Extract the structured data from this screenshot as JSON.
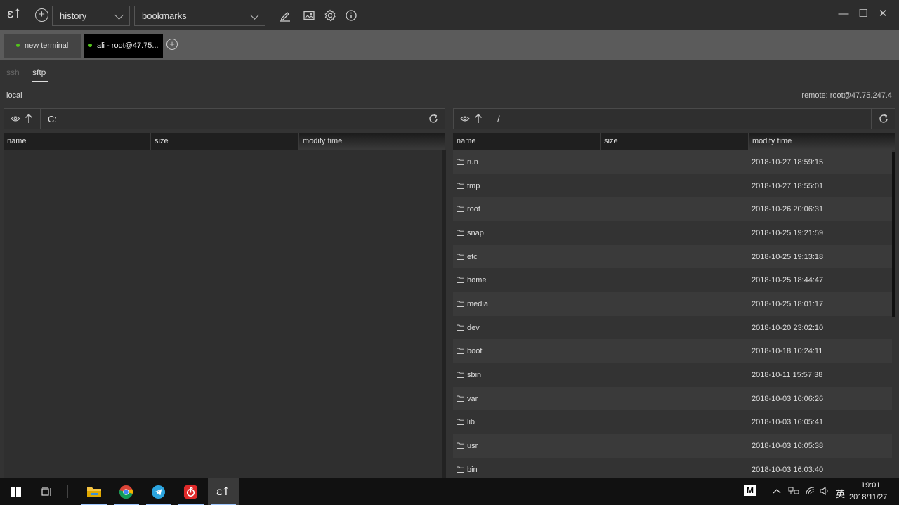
{
  "app": {
    "logo_text": "ɛ↑"
  },
  "toolbar": {
    "history_label": "history",
    "bookmarks_label": "bookmarks"
  },
  "window_controls": {
    "minimize": "—",
    "maximize": "☐",
    "close": "✕"
  },
  "tabs": [
    {
      "label": "new terminal",
      "status": "connected",
      "status_color": "#52c41a"
    },
    {
      "label": "ali - root@47.75...",
      "status": "connected",
      "status_color": "#52c41a",
      "active": true
    }
  ],
  "subtabs": {
    "ssh": "ssh",
    "sftp": "sftp",
    "active": "sftp"
  },
  "local": {
    "label": "local",
    "path": "C:",
    "columns": [
      "name",
      "size",
      "modify time"
    ]
  },
  "remote": {
    "label": "remote: root@47.75.247.4",
    "path": "/",
    "columns": [
      "name",
      "size",
      "modify time"
    ],
    "files": [
      {
        "name": "run",
        "time": "2018-10-27 18:59:15"
      },
      {
        "name": "tmp",
        "time": "2018-10-27 18:55:01"
      },
      {
        "name": "root",
        "time": "2018-10-26 20:06:31"
      },
      {
        "name": "snap",
        "time": "2018-10-25 19:21:59"
      },
      {
        "name": "etc",
        "time": "2018-10-25 19:13:18"
      },
      {
        "name": "home",
        "time": "2018-10-25 18:44:47"
      },
      {
        "name": "media",
        "time": "2018-10-25 18:01:17"
      },
      {
        "name": "dev",
        "time": "2018-10-20 23:02:10"
      },
      {
        "name": "boot",
        "time": "2018-10-18 10:24:11"
      },
      {
        "name": "sbin",
        "time": "2018-10-11 15:57:38"
      },
      {
        "name": "var",
        "time": "2018-10-03 16:06:26"
      },
      {
        "name": "lib",
        "time": "2018-10-03 16:05:41"
      },
      {
        "name": "usr",
        "time": "2018-10-03 16:05:38"
      },
      {
        "name": "bin",
        "time": "2018-10-03 16:03:40"
      }
    ]
  },
  "taskbar": {
    "clock_time": "19:01",
    "clock_date": "2018/11/27",
    "ime": "英",
    "tray_m": "M",
    "apps": [
      "start-icon",
      "task-view-icon",
      "file-explorer-icon",
      "chrome-icon",
      "telegram-icon",
      "netease-music-icon",
      "electerm-icon"
    ]
  }
}
